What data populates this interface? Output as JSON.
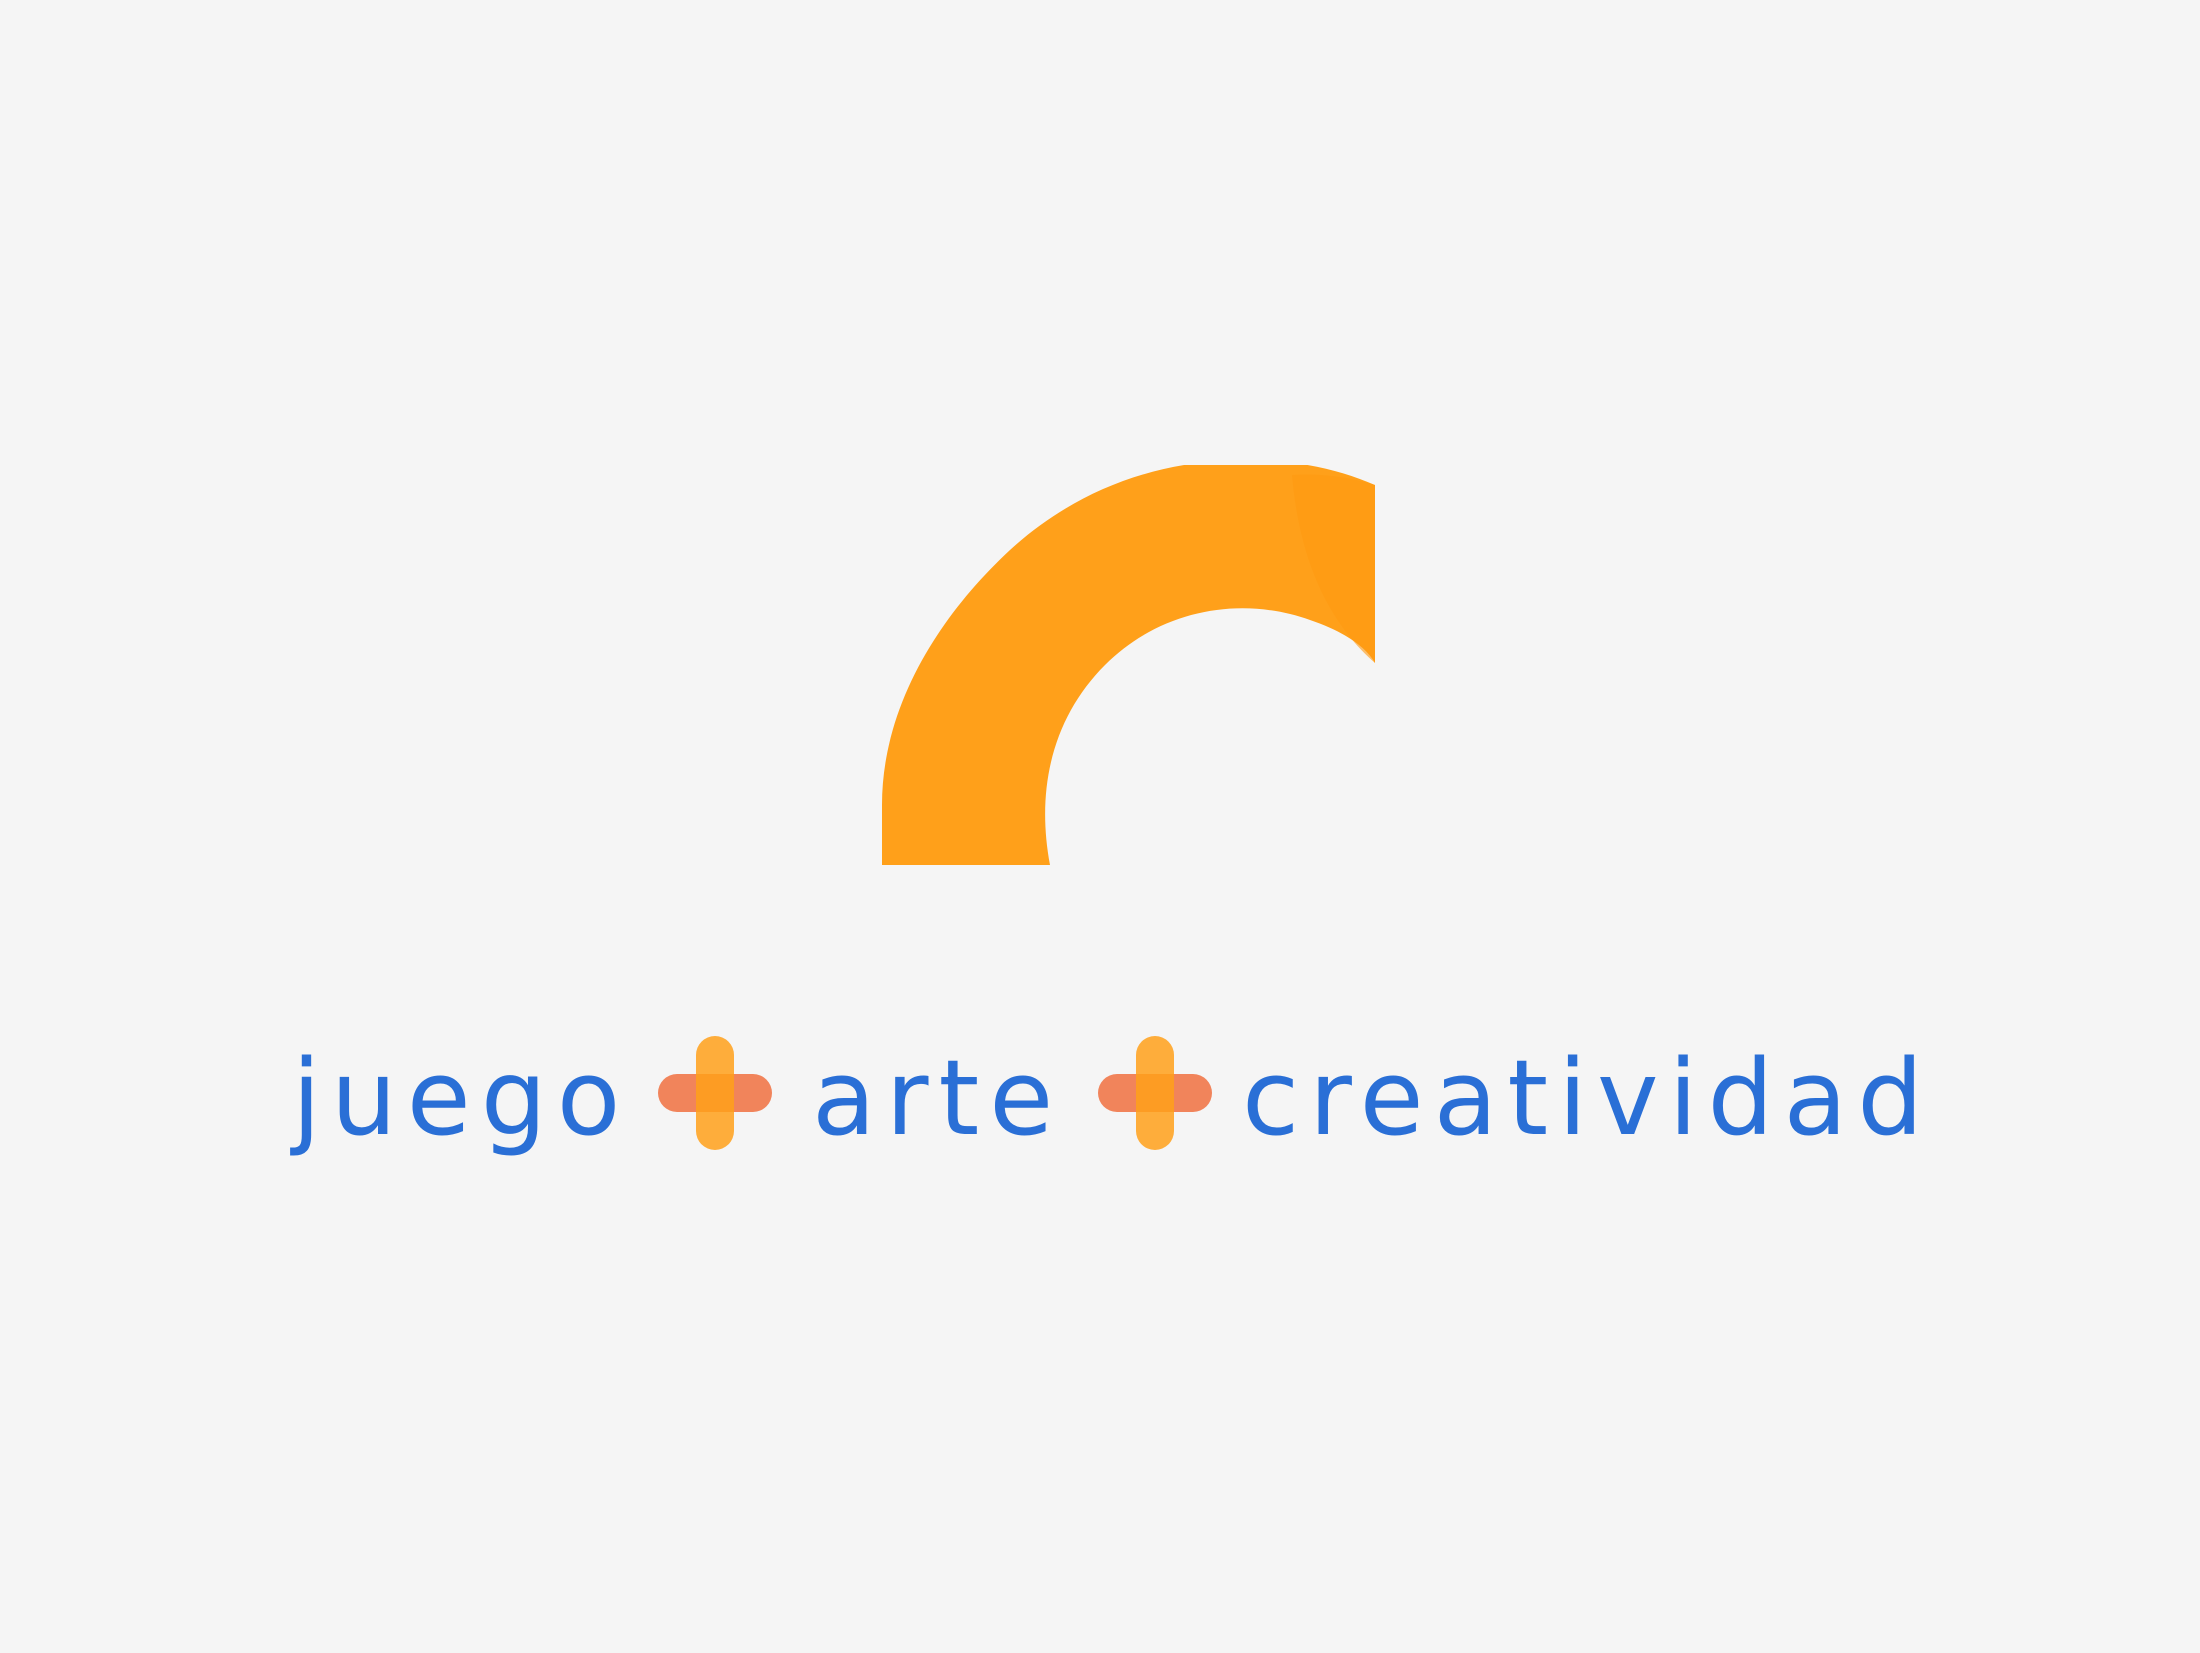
{
  "brand": {
    "accent_orange": "#ffa01a",
    "accent_red_orange": "#f07040",
    "text_blue": "#2a6fd6",
    "background": "#f5f5f5"
  },
  "tagline": {
    "words": [
      "juego",
      "arte",
      "creatividad"
    ],
    "separator_icon": "plus-icon"
  }
}
